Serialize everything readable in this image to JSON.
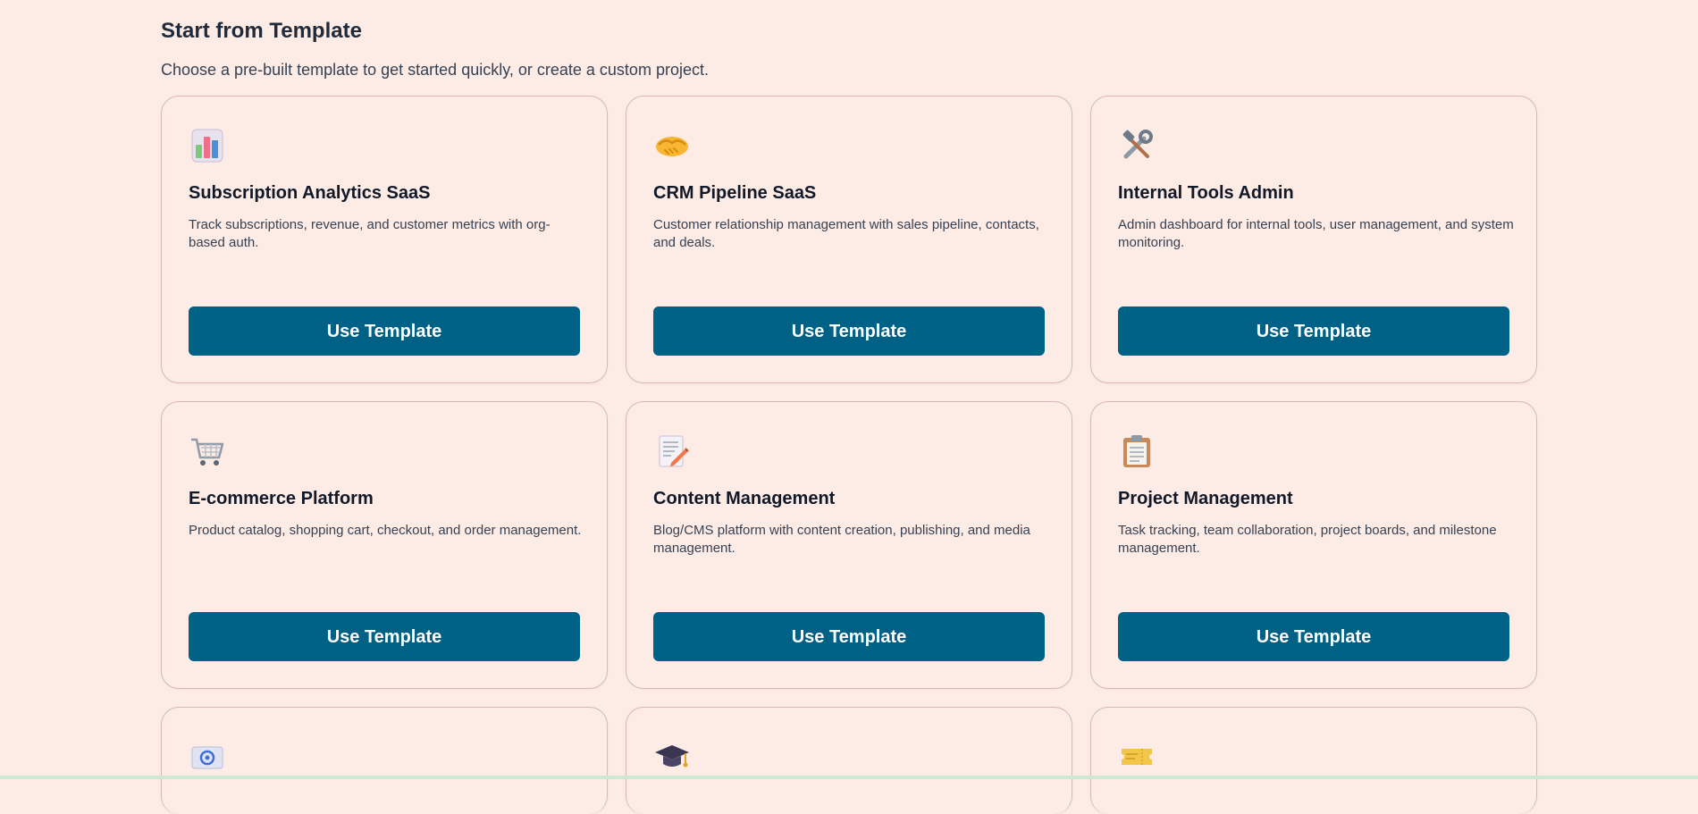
{
  "section": {
    "title": "Start from Template",
    "subtitle": "Choose a pre-built template to get started quickly, or create a custom project."
  },
  "templates": [
    {
      "icon": "bar-chart-icon",
      "title": "Subscription Analytics SaaS",
      "description": "Track subscriptions, revenue, and customer metrics with org-based auth.",
      "button_label": "Use Template"
    },
    {
      "icon": "handshake-icon",
      "title": "CRM Pipeline SaaS",
      "description": "Customer relationship management with sales pipeline, contacts, and deals.",
      "button_label": "Use Template"
    },
    {
      "icon": "tools-icon",
      "title": "Internal Tools Admin",
      "description": "Admin dashboard for internal tools, user management, and system monitoring.",
      "button_label": "Use Template"
    },
    {
      "icon": "shopping-cart-icon",
      "title": "E-commerce Platform",
      "description": "Product catalog, shopping cart, checkout, and order management.",
      "button_label": "Use Template"
    },
    {
      "icon": "memo-icon",
      "title": "Content Management",
      "description": "Blog/CMS platform with content creation, publishing, and media management.",
      "button_label": "Use Template"
    },
    {
      "icon": "clipboard-icon",
      "title": "Project Management",
      "description": "Task tracking, team collaboration, project boards, and milestone management.",
      "button_label": "Use Template"
    }
  ],
  "partial_cards": [
    {
      "icon": "email-icon"
    },
    {
      "icon": "graduation-cap-icon"
    },
    {
      "icon": "ticket-icon"
    }
  ],
  "colors": {
    "background": "#fdebe6",
    "button": "#006186",
    "card_border": "#d7b9b2"
  }
}
